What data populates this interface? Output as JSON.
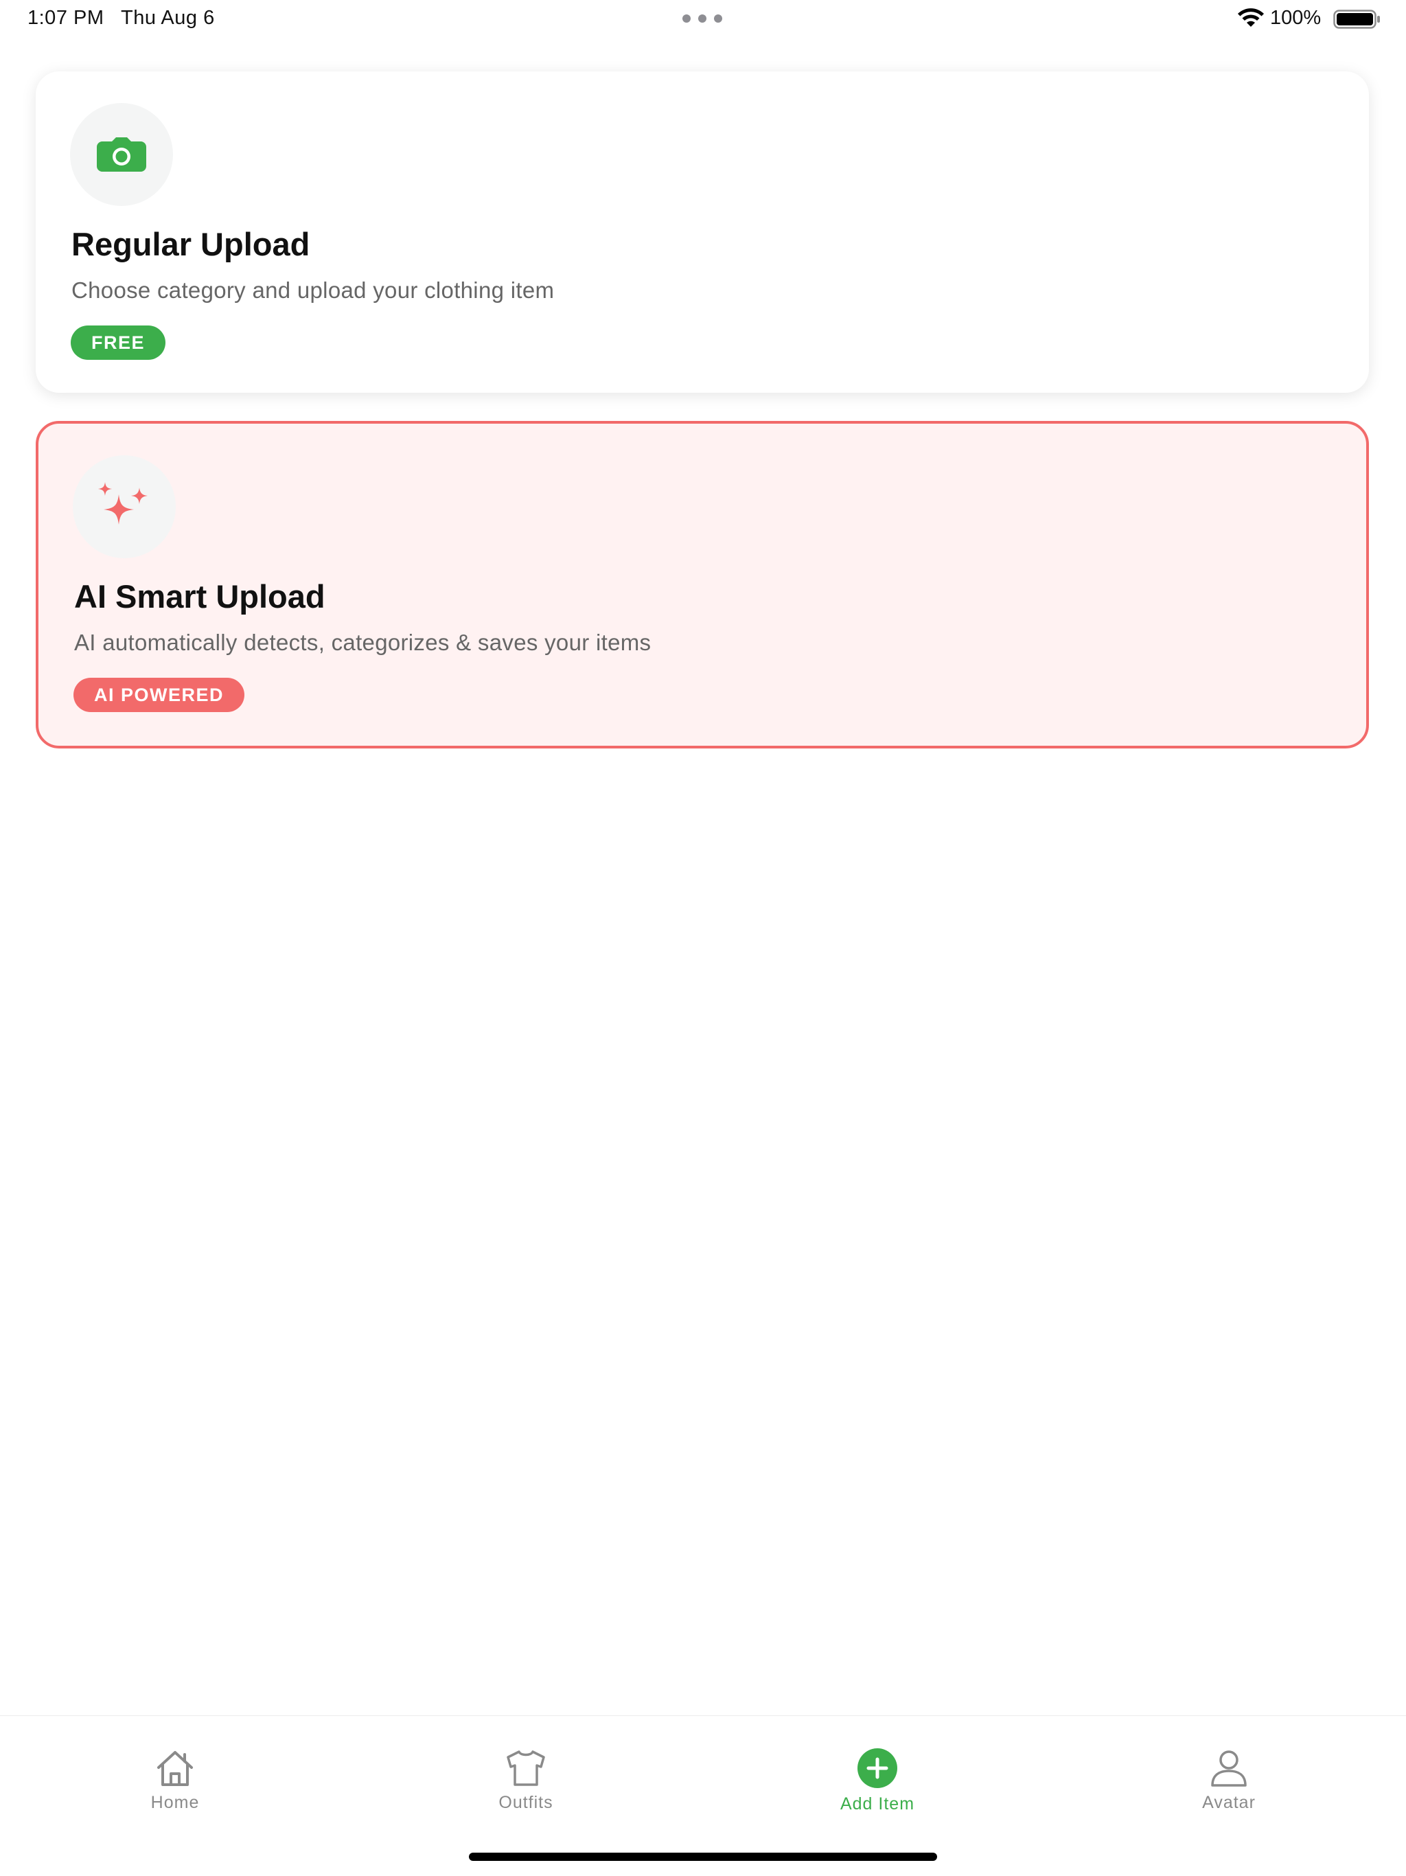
{
  "status_bar": {
    "time": "1:07 PM",
    "date": "Thu Aug 6",
    "battery_percent": "100%",
    "battery_level": 1.0
  },
  "cards": {
    "regular": {
      "icon": "camera-icon",
      "title": "Regular Upload",
      "description": "Choose category and upload your clothing item",
      "badge": "FREE",
      "accent_color": "#3cae4b"
    },
    "ai": {
      "icon": "sparkles-icon",
      "title": "AI Smart Upload",
      "description": "AI automatically detects, categorizes & saves your items",
      "badge": "AI POWERED",
      "accent_color": "#f26a6a"
    }
  },
  "tab_bar": {
    "active": "add",
    "items": [
      {
        "key": "home",
        "label": "Home",
        "icon": "house-icon"
      },
      {
        "key": "outfits",
        "label": "Outfits",
        "icon": "shirt-icon"
      },
      {
        "key": "add",
        "label": "Add Item",
        "icon": "plus-circle-icon"
      },
      {
        "key": "avatar",
        "label": "Avatar",
        "icon": "person-icon"
      }
    ],
    "active_color": "#3cae4b",
    "inactive_color": "#8a8a8a"
  }
}
